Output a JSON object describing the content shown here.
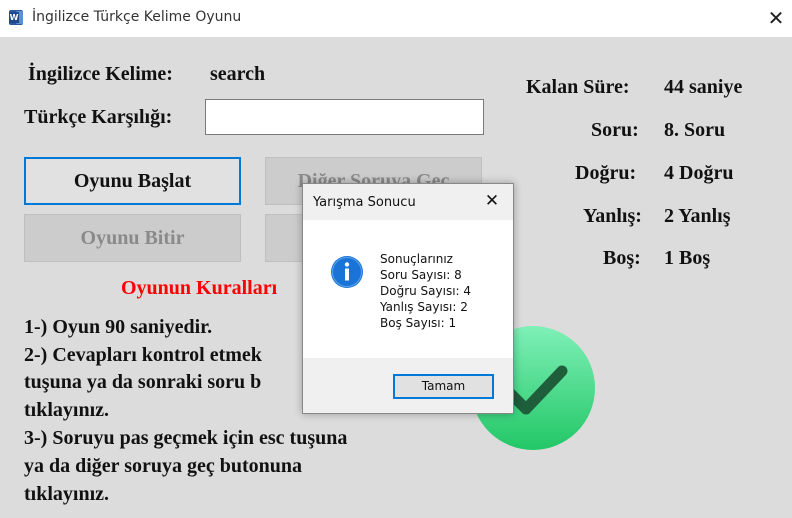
{
  "window": {
    "title": "İngilizce Türkçe Kelime Oyunu",
    "app_icon": "word-icon",
    "close_icon": "close-icon"
  },
  "form": {
    "word_label": "İngilizce Kelime:",
    "word_value": "search",
    "answer_label": "Türkçe Karşılığı:",
    "answer_value": "",
    "start_button": "Oyunu Başlat",
    "next_button": "Diğer Soruya Geç",
    "end_button": "Oyunu Bitir",
    "hidden_button": ""
  },
  "stats": {
    "time_label": "Kalan Süre:",
    "time_value": "44 saniye",
    "question_label": "Soru:",
    "question_value": "8. Soru",
    "correct_label": "Doğru:",
    "correct_value": "4 Doğru",
    "wrong_label": "Yanlış:",
    "wrong_value": "2 Yanlış",
    "empty_label": "Boş:",
    "empty_value": "1 Boş"
  },
  "rules": {
    "title": "Oyunun Kuralları",
    "lines": [
      "1-) Oyun 90 saniyedir.",
      "2-) Cevapları kontrol etmek",
      "tuşuna ya da sonraki soru b",
      "tıklayınız.",
      "3-) Soruyu pas geçmek için esc tuşuna",
      "ya da diğer soruya geç butonuna",
      "tıklayınız."
    ]
  },
  "dialog": {
    "title": "Yarışma Sonucu",
    "close_icon": "close-icon",
    "icon": "info-icon",
    "lines": [
      "Sonuçlarınız",
      "Soru Sayısı: 8",
      "Doğru Sayısı: 4",
      "Yanlış Sayısı: 2",
      "Boş Sayısı: 1"
    ],
    "ok_button": "Tamam"
  },
  "colors": {
    "accent": "#0078d7",
    "rules_title": "#ff0000",
    "check_green": "#3ddc84",
    "client_bg": "#dcdcdc"
  }
}
